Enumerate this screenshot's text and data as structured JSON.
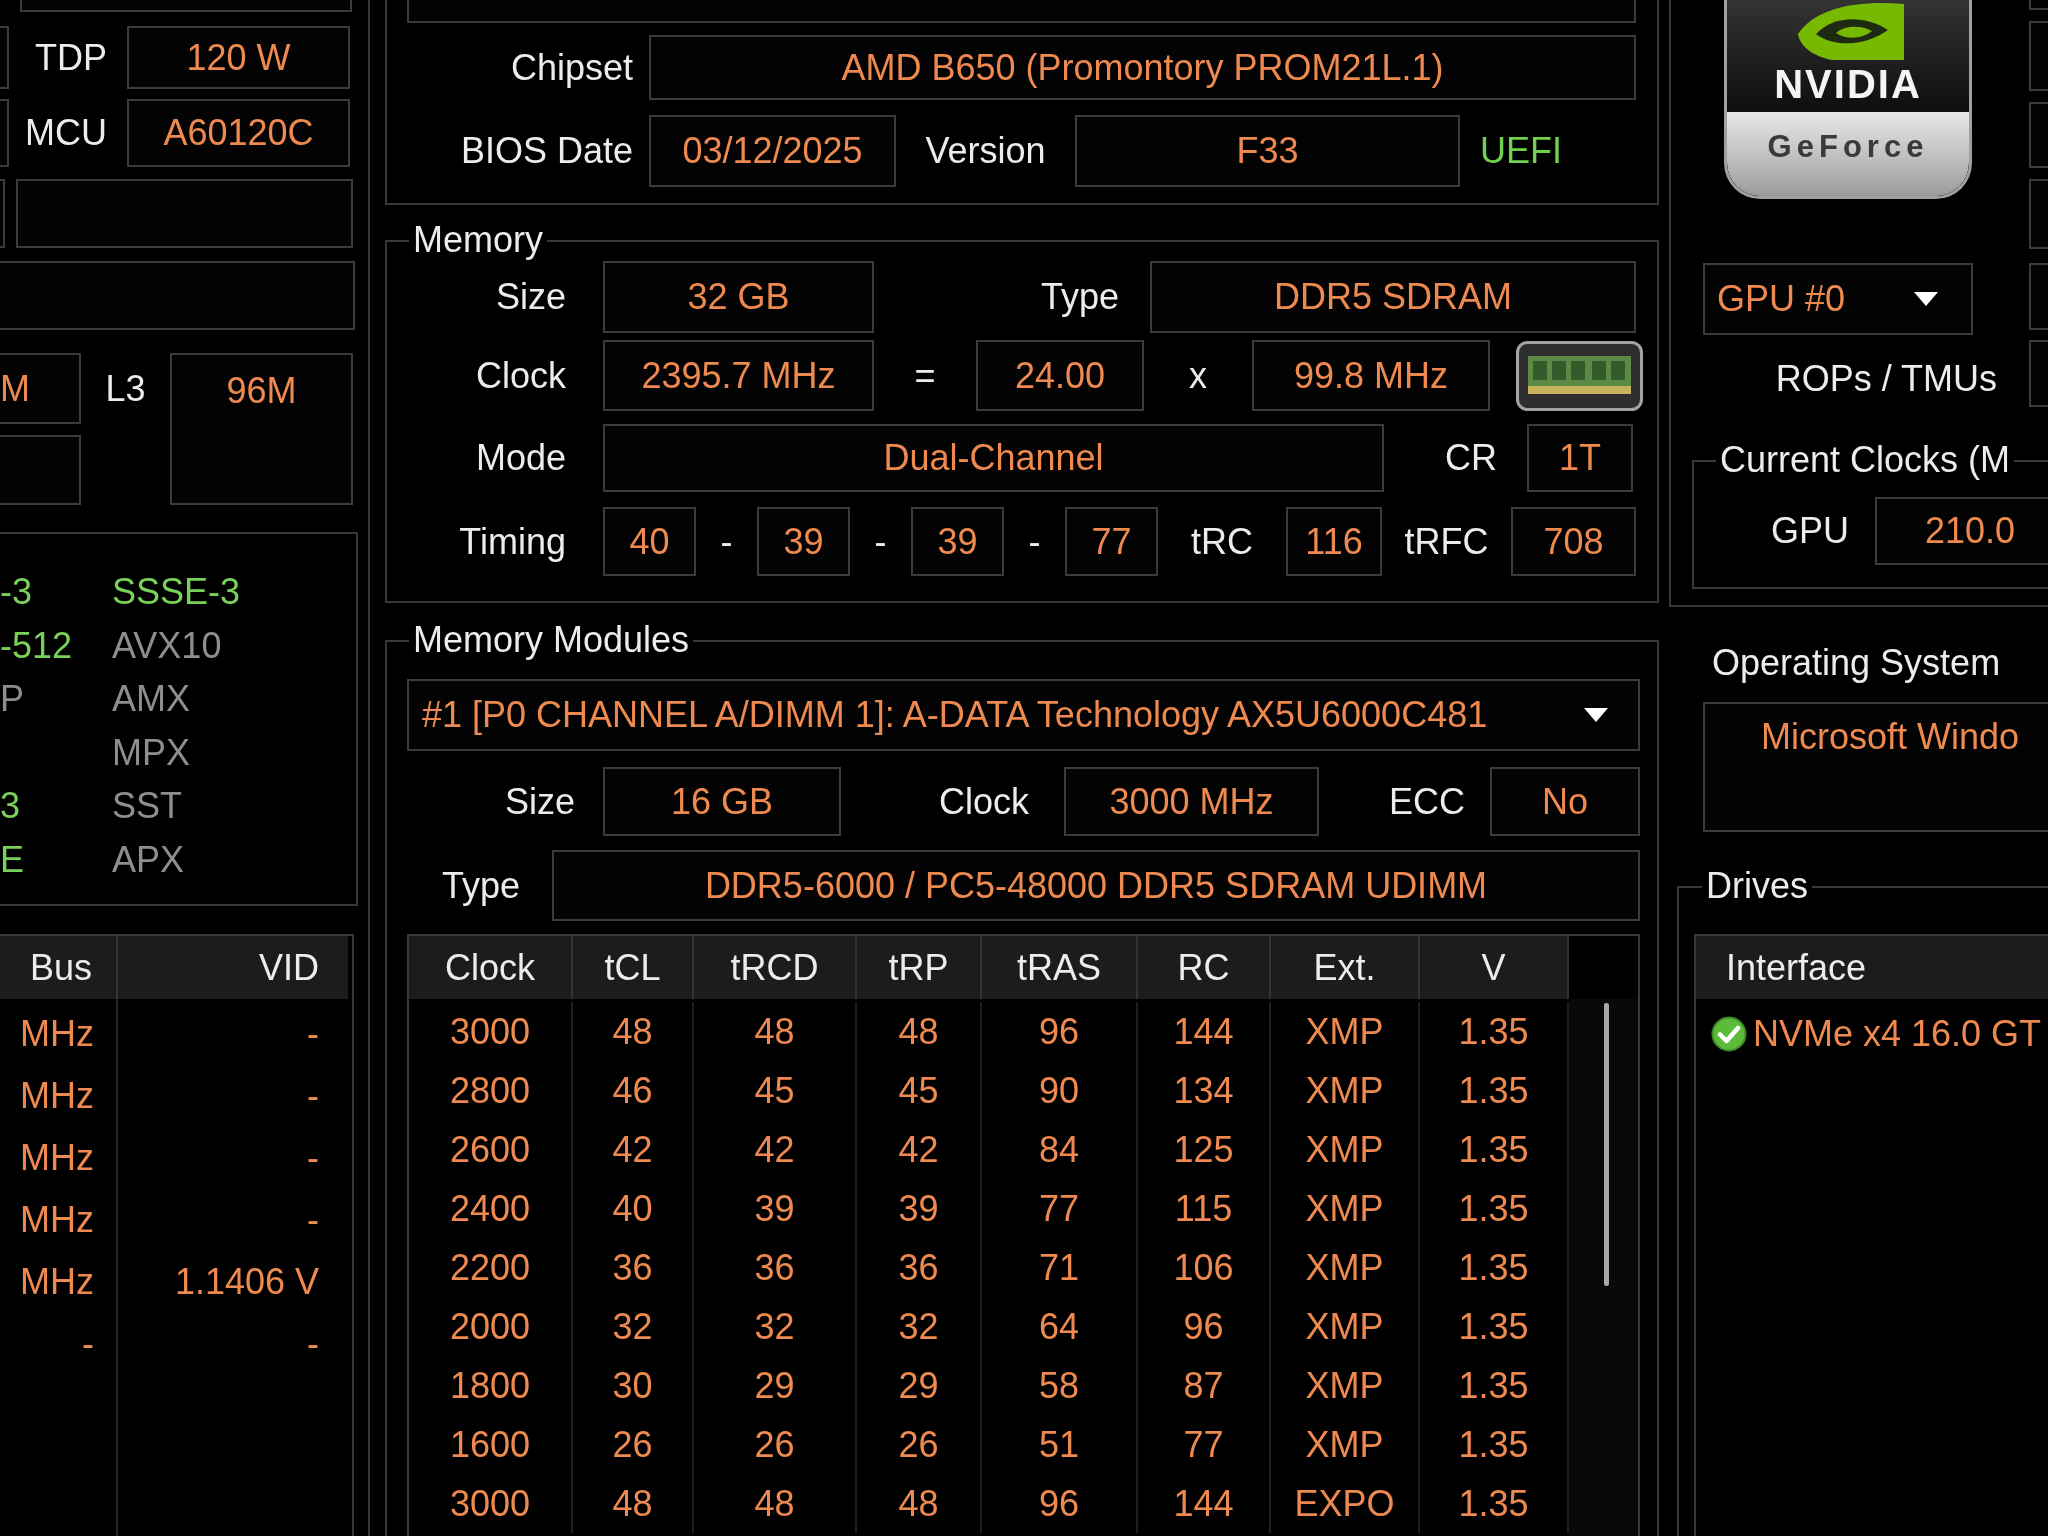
{
  "cpu": {
    "tdp": {
      "label": "TDP",
      "value": "120 W"
    },
    "mcu": {
      "label": "MCU",
      "value": "A60120C"
    },
    "cache": {
      "l2_value": "M",
      "l3_label": "L3",
      "l3_value": "96M"
    },
    "features": [
      {
        "column_1": {
          "name": "-3",
          "supported": true
        },
        "column_2": {
          "name": "SSSE-3",
          "supported": true
        }
      },
      {
        "column_1": {
          "name": "-512",
          "supported": true
        },
        "column_2": {
          "name": "AVX10",
          "supported": false
        }
      },
      {
        "column_1": {
          "name": "P",
          "supported": false
        },
        "column_2": {
          "name": "AMX",
          "supported": false
        }
      },
      {
        "column_2": {
          "name": "MPX",
          "supported": false
        }
      },
      {
        "column_1": {
          "name": "3",
          "supported": true
        },
        "column_2": {
          "name": "SST",
          "supported": false
        }
      },
      {
        "column_1": {
          "name": "E",
          "supported": true
        },
        "column_2": {
          "name": "APX",
          "supported": false
        }
      }
    ],
    "clock_table": {
      "columns": [
        "Bus",
        "VID"
      ],
      "rows": [
        [
          "MHz",
          "-"
        ],
        [
          "MHz",
          "-"
        ],
        [
          "MHz",
          "-"
        ],
        [
          "MHz",
          "-"
        ],
        [
          "MHz",
          "1.1406 V"
        ],
        [
          "-",
          "-"
        ]
      ]
    }
  },
  "motherboard": {
    "chipset": {
      "label": "Chipset",
      "value": "AMD B650 (Promontory PROM21L.1)"
    },
    "bios": {
      "date_label": "BIOS Date",
      "date": "03/12/2025",
      "version_label": "Version",
      "version": "F33",
      "mode": "UEFI"
    }
  },
  "memory": {
    "title": "Memory",
    "size_label": "Size",
    "size": "32 GB",
    "type_label": "Type",
    "type": "DDR5 SDRAM",
    "clock_label": "Clock",
    "clock": "2395.7 MHz",
    "equals": "=",
    "multiplier": "24.00",
    "times": "x",
    "bus_clock": "99.8 MHz",
    "mode_label": "Mode",
    "mode": "Dual-Channel",
    "cr_label": "CR",
    "cr": "1T",
    "timing_label": "Timing",
    "timing": [
      {
        "kind": "value",
        "text": "40"
      },
      {
        "kind": "separator",
        "text": "-"
      },
      {
        "kind": "value",
        "text": "39"
      },
      {
        "kind": "separator",
        "text": "-"
      },
      {
        "kind": "value",
        "text": "39"
      },
      {
        "kind": "separator",
        "text": "-"
      },
      {
        "kind": "value",
        "text": "77"
      }
    ],
    "trc_label": "tRC",
    "trc": "116",
    "trfc_label": "tRFC",
    "trfc": "708"
  },
  "memory_modules": {
    "title": "Memory Modules",
    "module": "#1 [P0 CHANNEL A/DIMM 1]: A-DATA Technology AX5U6000C481",
    "size_label": "Size",
    "size": "16 GB",
    "clock_label": "Clock",
    "clock": "3000 MHz",
    "ecc_label": "ECC",
    "ecc": "No",
    "type_label": "Type",
    "type": "DDR5-6000 / PC5-48000 DDR5 SDRAM UDIMM",
    "table": {
      "columns": [
        "Clock",
        "tCL",
        "tRCD",
        "tRP",
        "tRAS",
        "RC",
        "Ext.",
        "V"
      ],
      "rows": [
        [
          "3000",
          "48",
          "48",
          "48",
          "96",
          "144",
          "XMP",
          "1.35"
        ],
        [
          "2800",
          "46",
          "45",
          "45",
          "90",
          "134",
          "XMP",
          "1.35"
        ],
        [
          "2600",
          "42",
          "42",
          "42",
          "84",
          "125",
          "XMP",
          "1.35"
        ],
        [
          "2400",
          "40",
          "39",
          "39",
          "77",
          "115",
          "XMP",
          "1.35"
        ],
        [
          "2200",
          "36",
          "36",
          "36",
          "71",
          "106",
          "XMP",
          "1.35"
        ],
        [
          "2000",
          "32",
          "32",
          "32",
          "64",
          "96",
          "XMP",
          "1.35"
        ],
        [
          "1800",
          "30",
          "29",
          "29",
          "58",
          "87",
          "XMP",
          "1.35"
        ],
        [
          "1600",
          "26",
          "26",
          "26",
          "51",
          "77",
          "XMP",
          "1.35"
        ],
        [
          "3000",
          "48",
          "48",
          "48",
          "96",
          "144",
          "EXPO",
          "1.35"
        ]
      ]
    }
  },
  "gpu": {
    "logo": {
      "brand": "NVIDIA",
      "product": "GeForce"
    },
    "selector": "GPU #0",
    "rops_label": "ROPs / TMUs",
    "clocks": {
      "title": "Current Clocks (M",
      "gpu_label": "GPU",
      "gpu_value": "210.0"
    }
  },
  "operating_system": {
    "title": "Operating System",
    "value": "Microsoft Windo"
  },
  "drives": {
    "title": "Drives",
    "columns": [
      "Interface"
    ],
    "rows": [
      {
        "interface": "NVMe x4 16.0 GT",
        "healthy": true
      }
    ]
  }
}
